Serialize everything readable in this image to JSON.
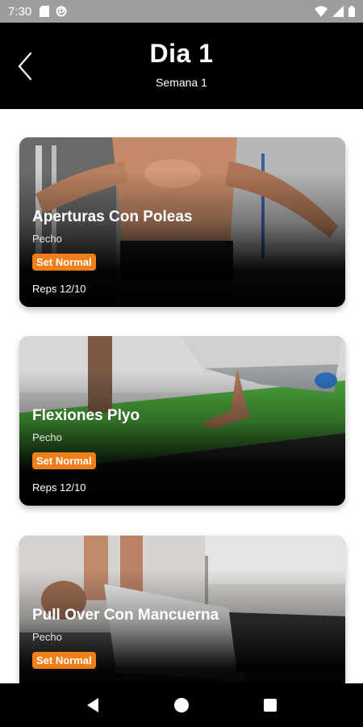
{
  "status_bar": {
    "time": "7:30",
    "icons_left": [
      "sd-card-icon",
      "data-saver-icon"
    ],
    "icons_right": [
      "wifi-icon",
      "signal-icon",
      "battery-icon"
    ]
  },
  "header": {
    "title": "Dia 1",
    "subtitle": "Semana 1",
    "back_icon": "chevron-left-icon",
    "background": "#000000"
  },
  "exercises": [
    {
      "name": "Aperturas Con Poleas",
      "muscle": "Pecho",
      "set_type": "Set Normal",
      "reps": "Reps 12/10"
    },
    {
      "name": "Flexiones Plyo",
      "muscle": "Pecho",
      "set_type": "Set Normal",
      "reps": "Reps 12/10"
    },
    {
      "name": "Pull Over Con Mancuerna",
      "muscle": "Pecho",
      "set_type": "Set Normal",
      "reps": ""
    }
  ],
  "colors": {
    "badge": "#f07f1a",
    "card_background": "#000000",
    "status_bar": "#9e9e9e"
  },
  "nav_bar": {
    "buttons": [
      "back-triangle-icon",
      "home-circle-icon",
      "recents-square-icon"
    ]
  }
}
